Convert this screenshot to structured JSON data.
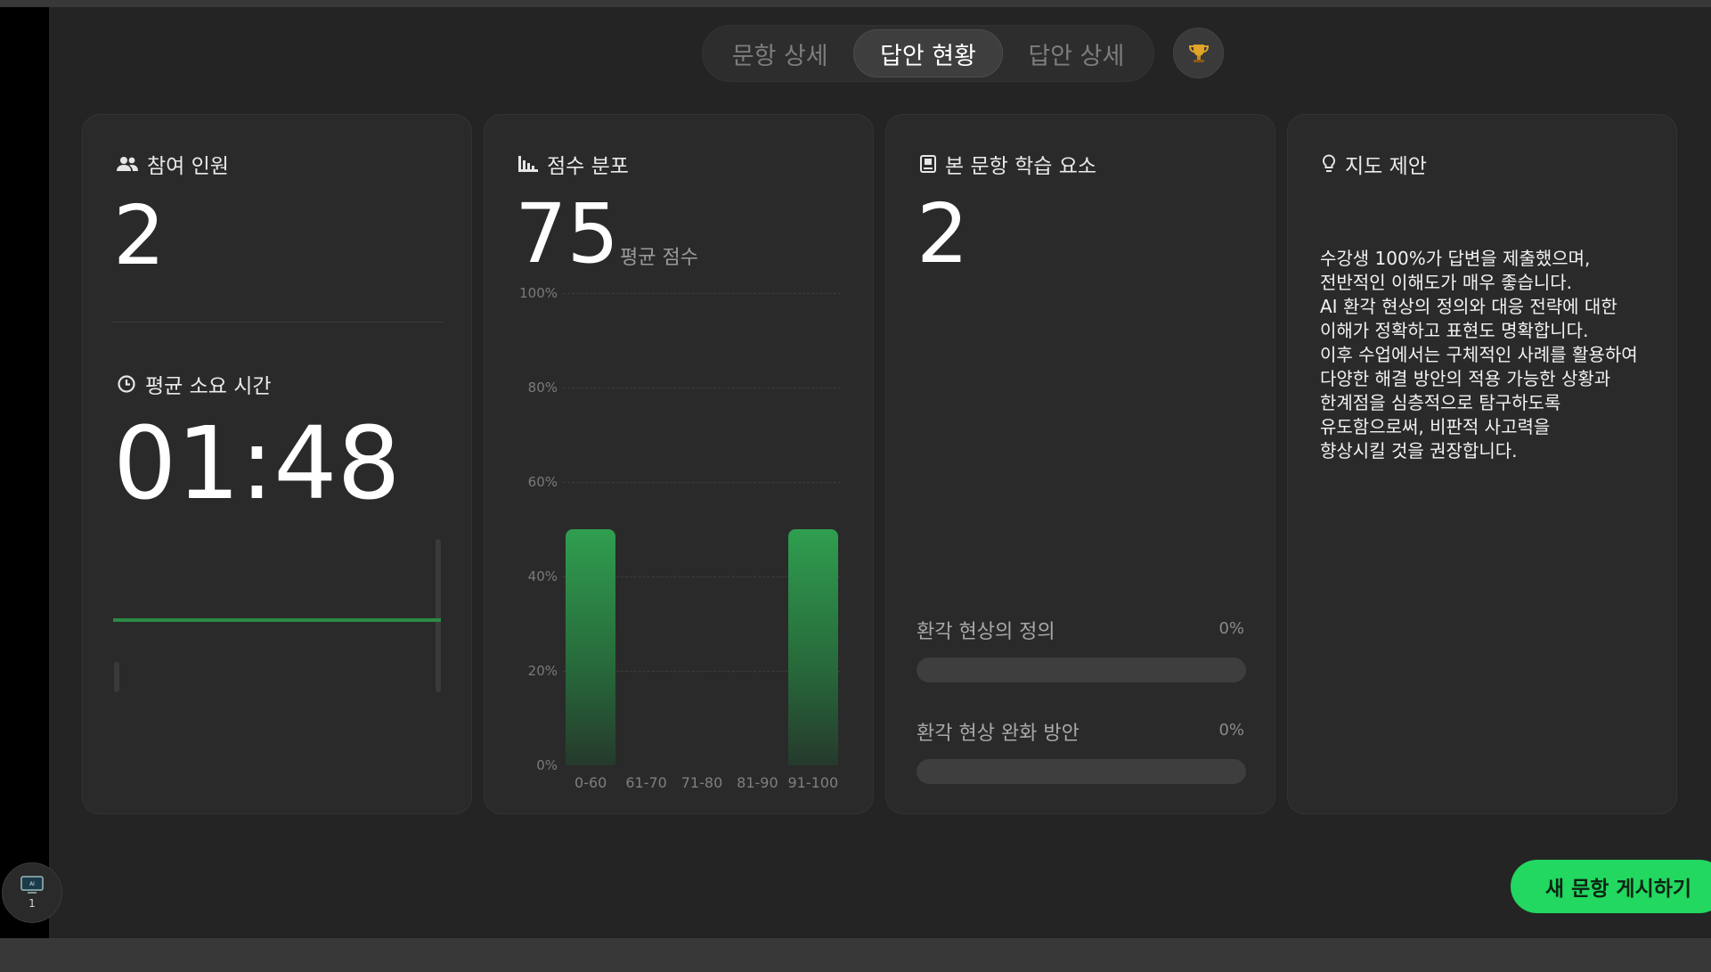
{
  "tabs": [
    {
      "label": "문항 상세",
      "active": false
    },
    {
      "label": "답안 현황",
      "active": true
    },
    {
      "label": "답안 상세",
      "active": false
    }
  ],
  "trophy_icon": "trophy-icon",
  "participants": {
    "title": "참여 인원",
    "icon": "people-icon",
    "count": "2"
  },
  "avg_time": {
    "title": "평균 소요 시간",
    "icon": "clock-icon",
    "value": "01:48"
  },
  "score_distribution": {
    "title": "점수 분포",
    "icon": "bar-chart-icon",
    "avg_score": "75",
    "avg_score_label": "평균 점수"
  },
  "chart_data": {
    "type": "bar",
    "categories": [
      "0-60",
      "61-70",
      "71-80",
      "81-90",
      "91-100"
    ],
    "values": [
      50,
      0,
      0,
      0,
      50
    ],
    "yticks": [
      "100%",
      "80%",
      "60%",
      "40%",
      "20%",
      "0%"
    ],
    "ylim": [
      0,
      100
    ],
    "grid": true,
    "bar_color": "#2f9e4f"
  },
  "learning_elements": {
    "title": "본 문항 학습 요소",
    "icon": "book-icon",
    "count": "2",
    "items": [
      {
        "label": "환각 현상의 정의",
        "pct": "0%",
        "value": 0
      },
      {
        "label": "환각 현상 완화 방안",
        "pct": "0%",
        "value": 0
      }
    ]
  },
  "suggestion": {
    "title": "지도 제안",
    "icon": "lightbulb-icon",
    "text": "수강생 100%가 답변을 제출했으며,\n전반적인 이해도가 매우 좋습니다.\nAI 환각 현상의 정의와 대응 전략에 대한\n이해가 정확하고 표현도 명확합니다.\n이후 수업에서는 구체적인 사례를 활용하여\n다양한 해결 방안의 적용 가능한 상황과\n한계점을 심층적으로 탐구하도록\n유도함으로써, 비판적 사고력을\n향상시킬 것을 권장합니다."
  },
  "cta_label": "새 문항 게시하기",
  "page_badge": {
    "icon": "slide-thumbnail-icon",
    "label": "AI",
    "number": "1"
  },
  "colors": {
    "accent": "#22d860",
    "background": "#242424",
    "card": "#2a2a2a"
  }
}
